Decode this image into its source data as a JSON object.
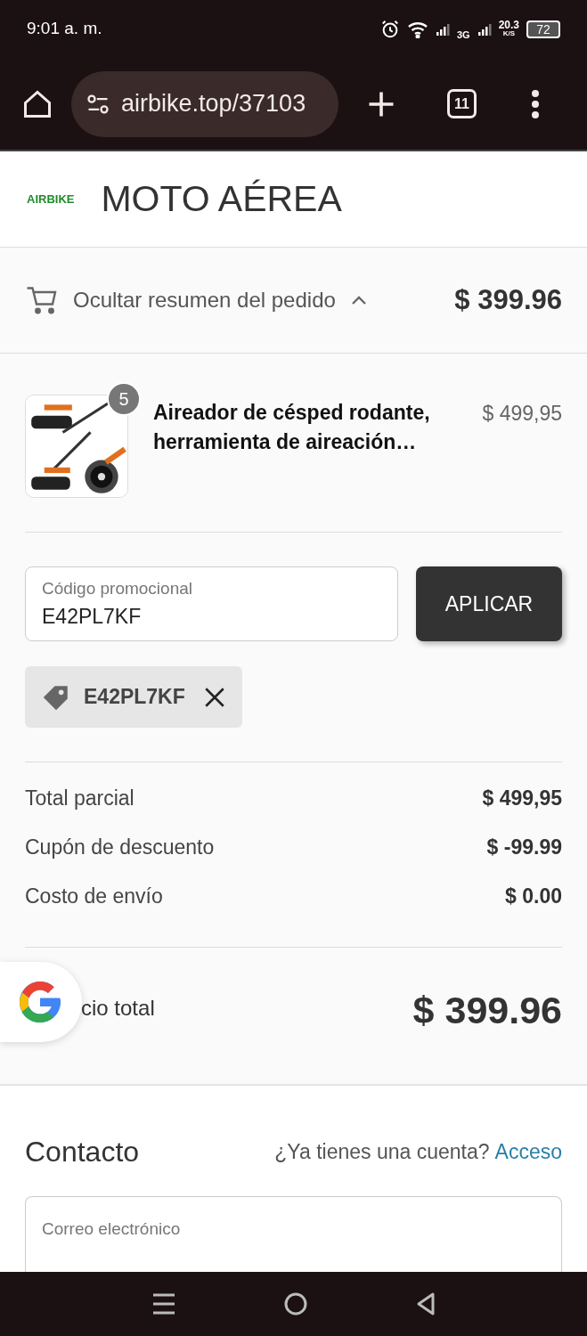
{
  "status_bar": {
    "time": "9:01 a. m.",
    "network": "3G",
    "speed": "20.3",
    "speed_unit": "K/S",
    "battery": "72"
  },
  "browser": {
    "url": "airbike.top/37103",
    "tab_count": "11"
  },
  "header": {
    "logo": "AIRBIKE",
    "store_name": "MOTO AÉREA"
  },
  "summary_toggle": {
    "label": "Ocultar resumen del pedido",
    "expanded": true,
    "total": "$ 399.96"
  },
  "product": {
    "quantity": "5",
    "name": "Aireador de césped rodante, herramienta de aireación…",
    "price": "$ 499,95"
  },
  "promo": {
    "placeholder": "Código promocional",
    "value": "E42PL7KF",
    "button": "APLICAR"
  },
  "applied_code": {
    "code": "E42PL7KF"
  },
  "totals": [
    {
      "label": "Total parcial",
      "value": "$ 499,95"
    },
    {
      "label": "Cupón de descuento",
      "value": "$ -99.99"
    },
    {
      "label": "Costo de envío",
      "value": "$ 0.00"
    }
  ],
  "grand_total": {
    "label": "cio total",
    "value": "$ 399.96"
  },
  "contact": {
    "title": "Contacto",
    "question": "¿Ya tienes una cuenta?",
    "link": "Acceso",
    "email_placeholder": "Correo electrónico"
  }
}
